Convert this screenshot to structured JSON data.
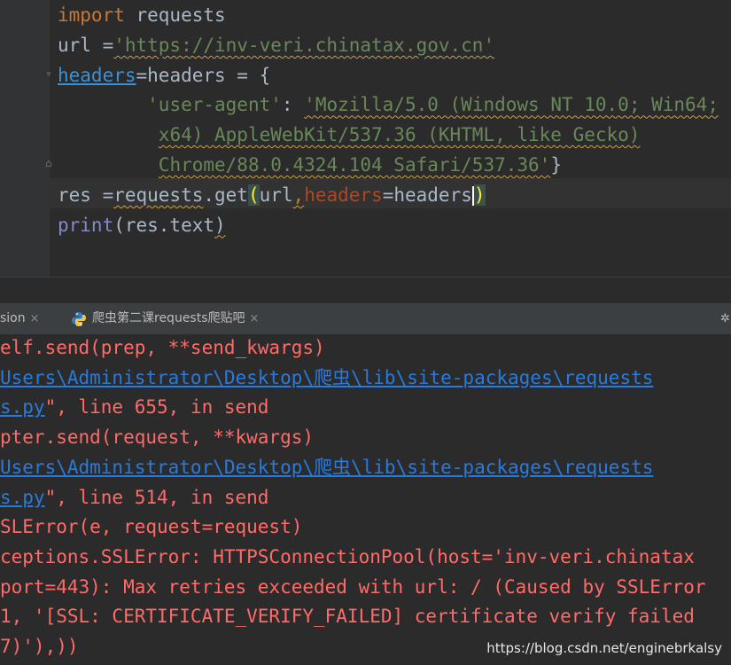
{
  "editor": {
    "lines": [
      [
        {
          "t": "import",
          "c": "kw"
        },
        {
          "t": " requests"
        }
      ],
      [
        {
          "t": "url ="
        },
        {
          "t": "'https://inv-veri.chinatax.gov.cn'",
          "c": "str squig"
        }
      ],
      [
        {
          "t": "headers",
          "c": "ref"
        },
        {
          "t": "=headers = {"
        }
      ],
      [
        {
          "t": "        "
        },
        {
          "t": "'user-agent'",
          "c": "str"
        },
        {
          "t": ": "
        },
        {
          "t": "'Mozilla/5.0 (Windows NT 10.0; Win64;",
          "c": "str squig"
        }
      ],
      [
        {
          "t": "         "
        },
        {
          "t": "x64) AppleWebKit/537.36 (KHTML, like Gecko)",
          "c": "str squig"
        }
      ],
      [
        {
          "t": "         "
        },
        {
          "t": "Chrome/88.0.4324.104 Safari/537.36'",
          "c": "str squig"
        },
        {
          "t": "}"
        }
      ],
      [
        {
          "t": "res ="
        },
        {
          "t": "requests",
          "c": "squig"
        },
        {
          "t": ".get"
        },
        {
          "t": "(",
          "c": "bracket-hl"
        },
        {
          "t": "url"
        },
        {
          "t": ",",
          "c": "kw squig"
        },
        {
          "t": "headers",
          "c": "kwarg"
        },
        {
          "t": "=headers"
        },
        {
          "t": "|",
          "c": "caret"
        },
        {
          "t": ")",
          "c": "bracket-hl"
        }
      ],
      [
        {
          "t": "print",
          "c": "fn"
        },
        {
          "t": "(res.text"
        },
        {
          "t": ")",
          "c": "squig"
        }
      ]
    ]
  },
  "tabs": [
    {
      "label": "sion",
      "close": "×"
    },
    {
      "label": "爬虫第二课requests爬贴吧",
      "close": "×"
    }
  ],
  "tab_settings_icon": "gear-icon",
  "console": {
    "lines": [
      [
        {
          "t": "elf.send(prep, **send_kwargs)"
        }
      ],
      [
        {
          "t": "Users\\Administrator\\Desktop\\爬虫\\lib\\site-packages\\requests",
          "c": "con-link"
        }
      ],
      [
        {
          "t": "s.py",
          "c": "con-link"
        },
        {
          "t": "\", line 655, in send"
        }
      ],
      [
        {
          "t": "pter.send(request, **kwargs)"
        }
      ],
      [
        {
          "t": "Users\\Administrator\\Desktop\\爬虫\\lib\\site-packages\\requests",
          "c": "con-link"
        }
      ],
      [
        {
          "t": "s.py",
          "c": "con-link"
        },
        {
          "t": "\", line 514, in send"
        }
      ],
      [
        {
          "t": "SLError(e, request=request)"
        }
      ],
      [
        {
          "t": "ceptions.SSLError: HTTPSConnectionPool(host='inv-veri.chinatax"
        }
      ],
      [
        {
          "t": "port=443): Max retries exceeded with url: / (Caused by SSLError"
        }
      ],
      [
        {
          "t": "1, '[SSL: CERTIFICATE_VERIFY_FAILED] certificate verify failed"
        }
      ],
      [
        {
          "t": "7)'),))"
        }
      ]
    ]
  },
  "watermark": "https://blog.csdn.net/enginebrkalsy"
}
